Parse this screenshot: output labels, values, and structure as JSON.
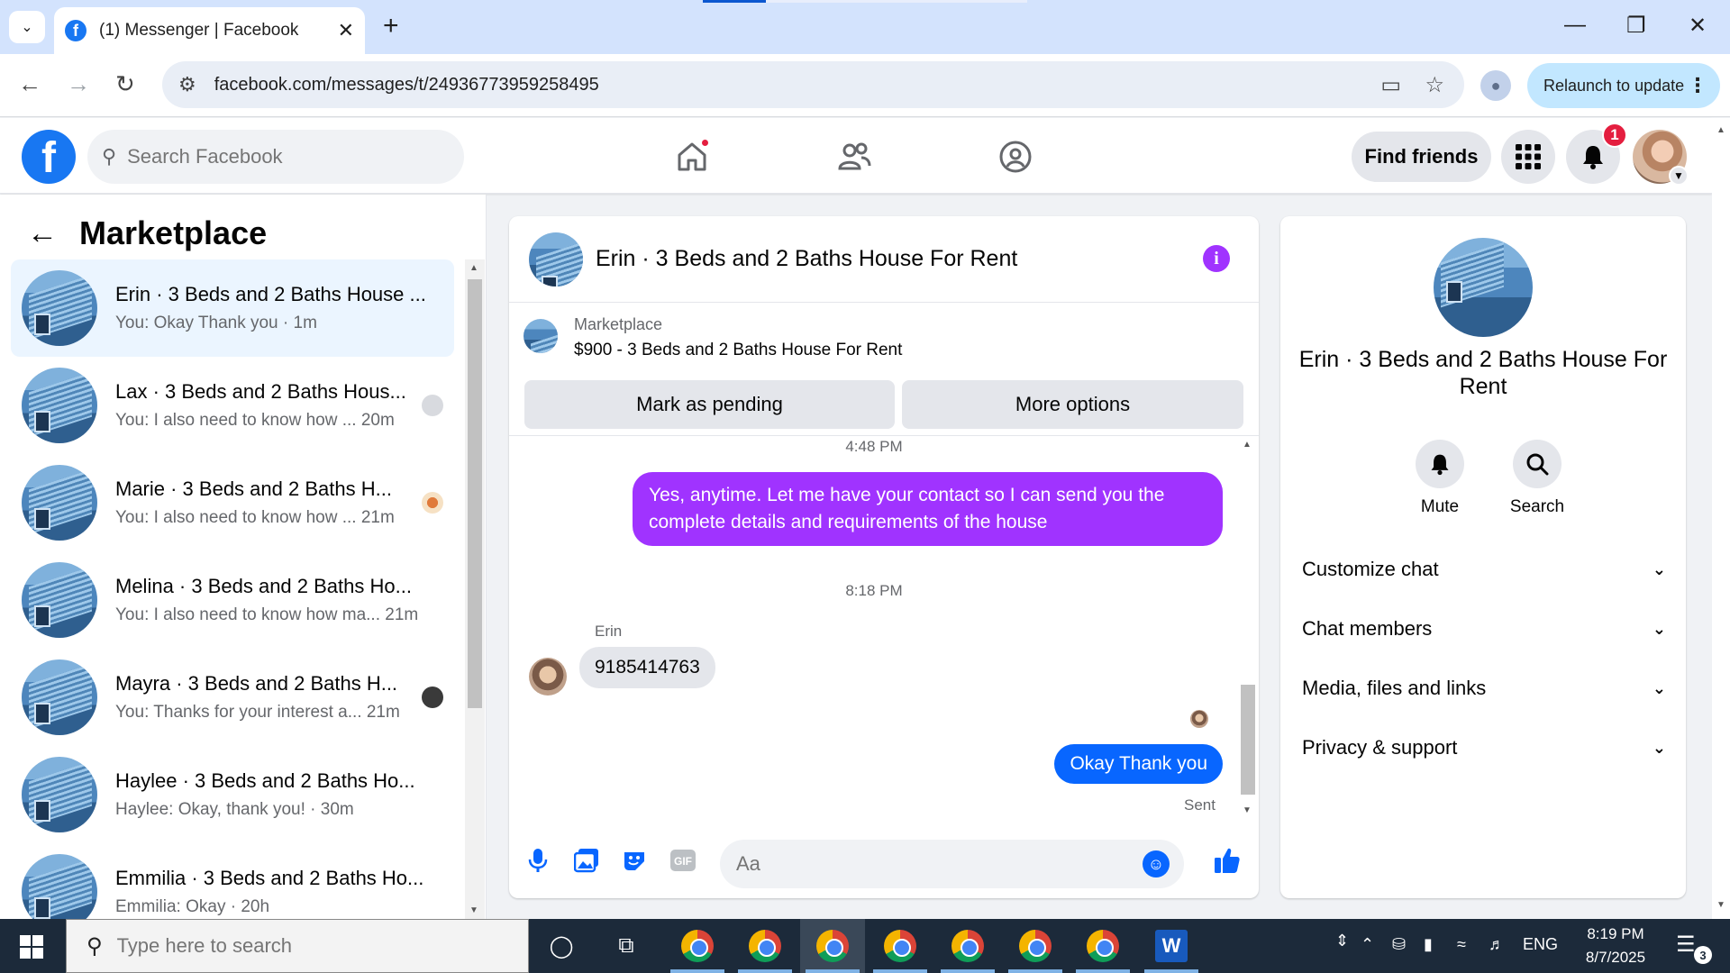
{
  "browser": {
    "tab_title": "(1) Messenger | Facebook",
    "url": "facebook.com/messages/t/24936773959258495",
    "relaunch_label": "Relaunch to update"
  },
  "fb_header": {
    "search_placeholder": "Search Facebook",
    "find_friends_label": "Find friends",
    "notification_count": "1"
  },
  "left_panel": {
    "title": "Marketplace",
    "conversations": [
      {
        "name": "Erin · 3 Beds and 2 Baths House ...",
        "preview": "You: Okay Thank you · 1m",
        "active": true
      },
      {
        "name": "Lax · 3 Beds and 2 Baths Hous...",
        "preview": "You: I also need to know how ...  20m"
      },
      {
        "name": "Marie · 3 Beds and 2 Baths H...",
        "preview": "You: I also need to know how ...  21m"
      },
      {
        "name": "Melina · 3 Beds and 2 Baths Ho...",
        "preview": "You: I also need to know how ma...  21m"
      },
      {
        "name": "Mayra · 3 Beds and 2 Baths H...",
        "preview": "You: Thanks for your interest a...  21m"
      },
      {
        "name": "Haylee · 3 Beds and 2 Baths Ho...",
        "preview": "Haylee: Okay, thank you! · 30m"
      },
      {
        "name": "Emmilia · 3 Beds and 2 Baths Ho...",
        "preview": "Emmilia: Okay · 20h"
      }
    ]
  },
  "chat": {
    "title": "Erin · 3 Beds and 2 Baths House For Rent",
    "listing_label": "Marketplace",
    "listing_price": "$900 - 3 Beds and 2 Baths House For Rent",
    "mark_pending_label": "Mark as pending",
    "more_options_label": "More options",
    "time1": "4:48 PM",
    "msg_out_1": "Yes, anytime. Let me have your contact so I can send you the complete details and requirements of the house",
    "time2": "8:18 PM",
    "sender": "Erin",
    "msg_in_1": "9185414763",
    "msg_out_2": "Okay Thank you",
    "sent_label": "Sent",
    "composer_placeholder": "Aa"
  },
  "right_panel": {
    "name": "Erin · 3 Beds and 2 Baths House For Rent",
    "mute_label": "Mute",
    "search_label": "Search",
    "sections": [
      "Customize chat",
      "Chat members",
      "Media, files and links",
      "Privacy & support"
    ]
  },
  "taskbar": {
    "search_placeholder": "Type here to search",
    "language": "ENG",
    "time": "8:19 PM",
    "date": "8/7/2025",
    "notification_count": "3"
  },
  "colors": {
    "fb_blue": "#1877f2",
    "message_purple": "#a033ff",
    "message_blue": "#0866ff"
  }
}
